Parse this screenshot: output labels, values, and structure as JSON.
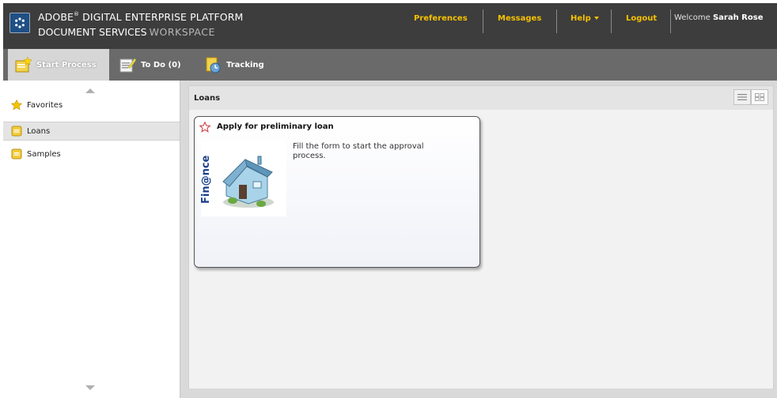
{
  "header": {
    "brand_line1": "ADOBE",
    "brand_line1_rest": " DIGITAL ENTERPRISE PLATFORM",
    "brand_line2": "DOCUMENT SERVICES",
    "brand_line2_ws": "WORKSPACE",
    "nav": {
      "preferences": "Preferences",
      "messages": "Messages",
      "help": "Help",
      "logout": "Logout"
    },
    "welcome_prefix": "Welcome",
    "user_name": "Sarah Rose"
  },
  "tabs": {
    "start_process": "Start Process",
    "todo": "To Do (0)",
    "tracking": "Tracking"
  },
  "sidebar": {
    "items": [
      {
        "label": "Favorites",
        "icon": "star-icon"
      },
      {
        "label": "Loans",
        "icon": "folder-icon"
      },
      {
        "label": "Samples",
        "icon": "folder-icon"
      }
    ]
  },
  "main": {
    "title": "Loans",
    "card": {
      "title": "Apply for preliminary loan",
      "description": "Fill the form to start the approval process.",
      "logo_text": "Fin@nce"
    }
  },
  "colors": {
    "header_bg": "#3d3d3d",
    "nav_accent": "#f5c000",
    "tabbar_bg": "#6a6a6a"
  }
}
